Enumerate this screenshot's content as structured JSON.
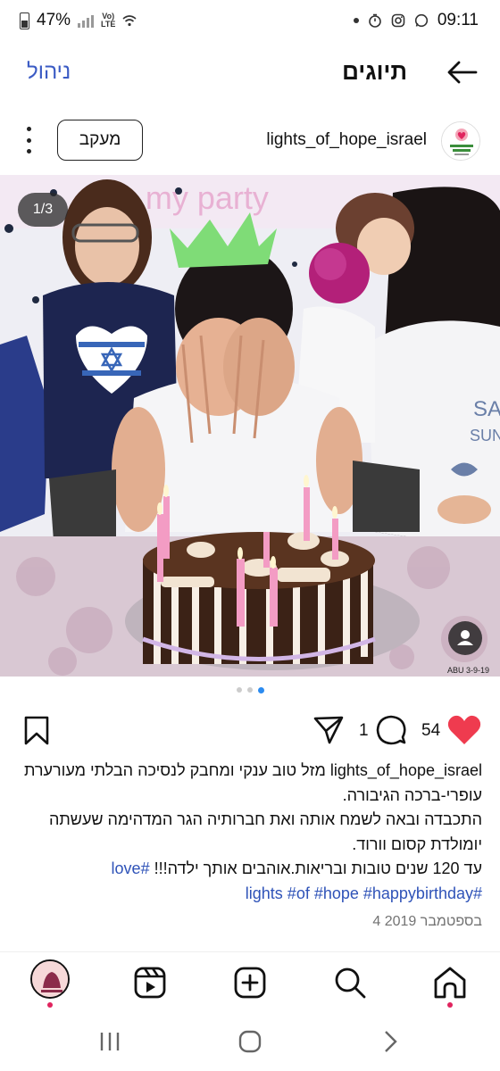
{
  "status_bar": {
    "battery": "47%",
    "network": "Vo)) LTE",
    "time": "09:11"
  },
  "header": {
    "manage_label": "ניהול",
    "title": "תיוגים"
  },
  "post": {
    "username": "lights_of_hope_israel",
    "follow_label": "מעקב",
    "page_counter": "1/3",
    "photo_date_stamp": "ABU 3-9-19",
    "likes": "54",
    "comments": "1",
    "caption_username": "lights_of_hope_israel",
    "caption_line1": "מזל טוב ענקי ומחבק לנסיכה הבלתי מעורערת עופרי-ברכה הגיבורה.",
    "caption_line2": "התכבדה ובאה לשמח אותה ואת חברותיה הגר המדהימה שעשתה יומולדת קסום וורוד.",
    "caption_line3_text": "עד 120 שנים טובות ובריאות.אוהבים אותך ילדה!!! ",
    "caption_line3_tag": "#love",
    "caption_line4_tags": "#lights #of #hope #happybirthday",
    "date": "4 בספטמבר 2019"
  },
  "colors": {
    "accent_blue": "#3b5bc4",
    "like_red": "#ef3b4f",
    "carousel_active": "#2b8bf0"
  },
  "icons": {
    "back": "back-arrow-icon",
    "more": "more-options-icon",
    "bookmark": "bookmark-icon",
    "share": "share-icon",
    "comment": "comment-icon",
    "like": "heart-icon",
    "home": "home-icon",
    "search": "search-icon",
    "create": "create-icon",
    "reels": "reels-icon",
    "profile": "profile-avatar-icon"
  }
}
